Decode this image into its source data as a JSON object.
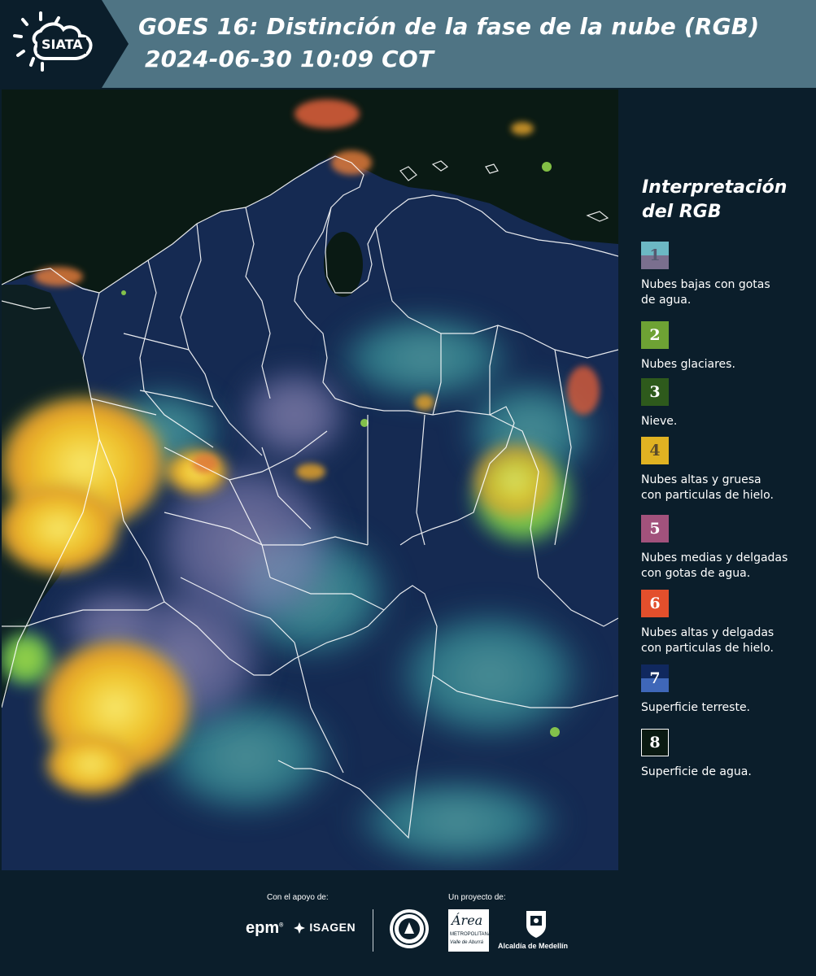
{
  "header": {
    "logo_text": "SIATA",
    "title_line1": "GOES 16: Distinción de la fase de la nube (RGB)",
    "title_line2": "2024-06-30 10:09 COT"
  },
  "legend": {
    "title": "Interpretación del RGB",
    "items": [
      {
        "number": "1",
        "text": [
          "Nubes bajas con gotas",
          "de agua."
        ],
        "color_top": "#6cb8c4",
        "color_bottom": "#7a6f8e"
      },
      {
        "number": "2",
        "text": [
          "Nubes glaciares."
        ],
        "color_top": "#6ea234",
        "color_bottom": "#6ea234"
      },
      {
        "number": "3",
        "text": [
          "Nieve."
        ],
        "color_top": "#2e5a1c",
        "color_bottom": "#2e5a1c"
      },
      {
        "number": "4",
        "text": [
          "Nubes altas y gruesa",
          "con particulas de hielo."
        ],
        "color_top": "#e0b222",
        "color_bottom": "#e0b222"
      },
      {
        "number": "5",
        "text": [
          "Nubes medias y delgadas",
          "con gotas de agua."
        ],
        "color_top": "#a2527c",
        "color_bottom": "#a2527c"
      },
      {
        "number": "6",
        "text": [
          "Nubes altas y delgadas",
          "con particulas de hielo."
        ],
        "color_top": "#e34f2c",
        "color_bottom": "#e34f2c"
      },
      {
        "number": "7",
        "text": [
          "Superficie terreste."
        ],
        "color_top": "#10285e",
        "color_bottom": "#3f67b8"
      },
      {
        "number": "8",
        "text": [
          "Superficie de agua."
        ],
        "color_top": "#0a1a12",
        "color_bottom": "#0a1a12"
      }
    ]
  },
  "footer": {
    "support_label": "Con el apoyo de:",
    "project_label": "Un proyecto de:",
    "sponsors": [
      "epm",
      "ISAGEN"
    ],
    "partners": {
      "area_name": "Área",
      "area_sub1": "METROPOLITANA",
      "area_sub2": "Valle de Aburrá",
      "alcaldia": "Alcaldía de Medellín"
    }
  },
  "colors": {
    "header_bg": "#4f7484",
    "page_bg": "#0b1e2b",
    "accent_white": "#ffffff"
  }
}
